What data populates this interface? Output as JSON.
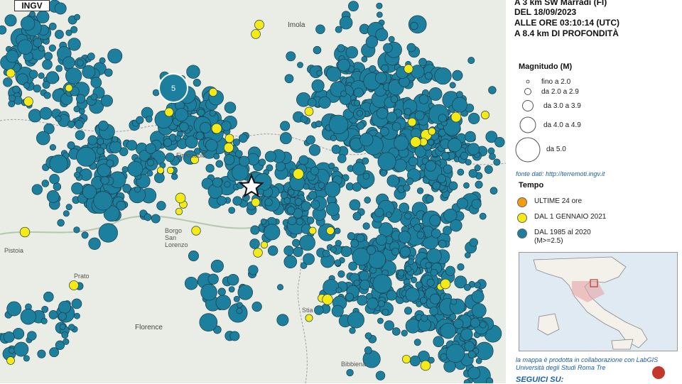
{
  "logo": "INGV",
  "map": {
    "cities": [
      "Imola",
      "Firenzuola",
      "Borgo San Lorenzo",
      "Pistoia",
      "Prato",
      "Florence",
      "Stia",
      "Bibbiena"
    ],
    "epicenter_label": "epicentro",
    "cluster_label": "5",
    "colors": {
      "past": "#1c7f9e",
      "recent_year": "#f5ea16",
      "last24h": "#f39c12",
      "background": "#e9ede6"
    }
  },
  "header": {
    "line1": "A 3 km SW Marradi (FI)",
    "line2": "DEL 18/09/2023",
    "line3": "ALLE ORE 03:10:14 (UTC)",
    "line4": "A 8.4 km DI PROFONDITÀ"
  },
  "legend_magnitude": {
    "title": "Magnitudo (M)",
    "items": [
      "fino a 2.0",
      "da 2.0 a 2.9",
      "da 3.0 a 3.9",
      "da 4.0 a 4.9",
      "da 5.0"
    ]
  },
  "source": "fonte dati: http://terremoti.ingv.it",
  "legend_time": {
    "title": "Tempo",
    "items": [
      {
        "label": "ULTIME 24 ore",
        "color": "#f39c12"
      },
      {
        "label": "DAL 1 GENNAIO 2021",
        "color": "#f5ea16"
      },
      {
        "label": "DAL 1985 al 2020",
        "sub": "(M>=2.5)",
        "color": "#1c7f9e"
      }
    ]
  },
  "credit": "la mappa è prodotta in collaborazione con LabGIS Università degli Studi Roma Tre",
  "follow": "SEGUICI SU:"
}
